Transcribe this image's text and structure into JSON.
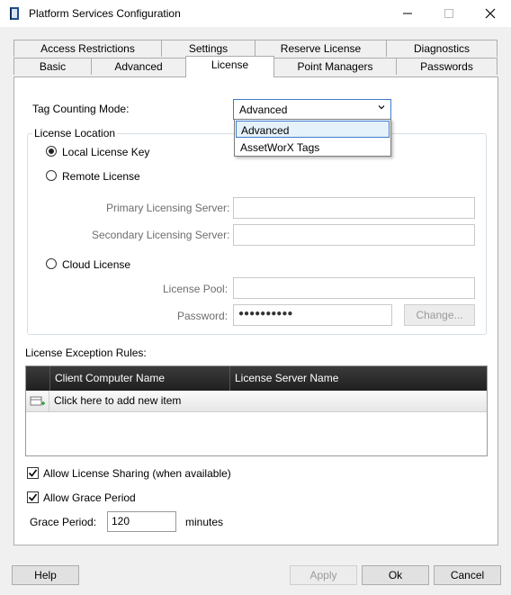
{
  "window": {
    "title": "Platform Services Configuration",
    "icon": "book-icon",
    "controls": [
      "minimize-icon",
      "maximize-icon",
      "close-icon"
    ]
  },
  "tabs": {
    "row_back": [
      "Access Restrictions",
      "Settings",
      "Reserve License",
      "Diagnostics"
    ],
    "row_front": [
      "Basic",
      "Advanced",
      "License",
      "Point Managers",
      "Passwords"
    ],
    "active": "License"
  },
  "tag_counting": {
    "label": "Tag Counting Mode:",
    "value": "Advanced",
    "options": [
      "Advanced",
      "AssetWorX Tags"
    ]
  },
  "license_location": {
    "legend": "License Location",
    "local": "Local License Key",
    "remote": "Remote License",
    "primary_label": "Primary Licensing Server:",
    "primary_value": "",
    "secondary_label": "Secondary Licensing Server:",
    "secondary_value": "",
    "cloud": "Cloud License",
    "pool_label": "License Pool:",
    "pool_value": "",
    "password_label": "Password:",
    "password_value": "●●●●●●●●●●",
    "change_button": "Change..."
  },
  "exceptions": {
    "label": "License Exception Rules:",
    "columns": [
      "Client Computer Name",
      "License Server Name"
    ],
    "new_row": "Click here to add new item"
  },
  "options": {
    "sharing": "Allow License Sharing (when available)",
    "grace": "Allow Grace Period",
    "grace_period_label": "Grace Period:",
    "grace_period_value": "120",
    "grace_period_unit": "minutes"
  },
  "buttons": {
    "help": "Help",
    "apply": "Apply",
    "ok": "Ok",
    "cancel": "Cancel"
  },
  "colors": {
    "accent": "#3e7cc7",
    "grid_header": "#2b2b2b",
    "gray_text": "#6d6d6d"
  }
}
